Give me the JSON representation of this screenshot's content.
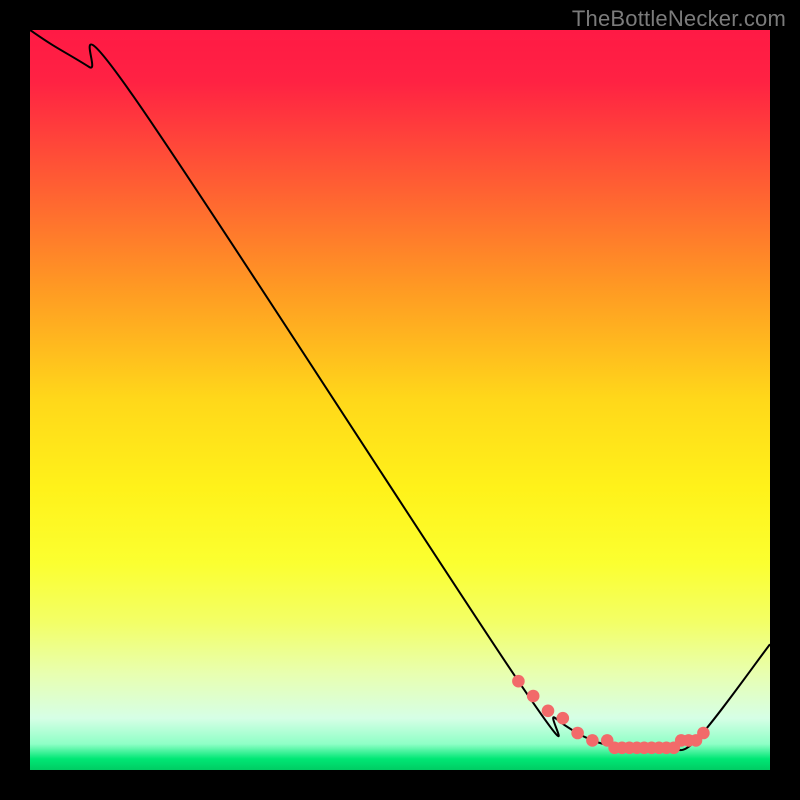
{
  "attribution": "TheBottleNecker.com",
  "chart_data": {
    "type": "line",
    "title": "",
    "xlabel": "",
    "ylabel": "",
    "xlim": [
      0,
      100
    ],
    "ylim": [
      0,
      100
    ],
    "gradient_stops": [
      {
        "offset": 0.0,
        "color": "#ff1a45"
      },
      {
        "offset": 0.07,
        "color": "#ff2243"
      },
      {
        "offset": 0.2,
        "color": "#ff5a34"
      },
      {
        "offset": 0.35,
        "color": "#ff9a23"
      },
      {
        "offset": 0.5,
        "color": "#ffd81a"
      },
      {
        "offset": 0.62,
        "color": "#fff21a"
      },
      {
        "offset": 0.72,
        "color": "#fbff30"
      },
      {
        "offset": 0.8,
        "color": "#f3ff66"
      },
      {
        "offset": 0.87,
        "color": "#e8ffb0"
      },
      {
        "offset": 0.93,
        "color": "#d6ffe6"
      },
      {
        "offset": 0.965,
        "color": "#8effc6"
      },
      {
        "offset": 0.985,
        "color": "#00e775"
      },
      {
        "offset": 1.0,
        "color": "#00cc63"
      }
    ],
    "series": [
      {
        "name": "bottleneck-curve",
        "type": "line",
        "x": [
          0,
          3,
          8,
          14,
          66,
          71,
          76,
          81,
          86,
          90,
          100
        ],
        "y": [
          100,
          98,
          95,
          91,
          12,
          7,
          4,
          3,
          3,
          4,
          17
        ]
      },
      {
        "name": "optimal-zone-markers",
        "type": "scatter",
        "x": [
          66,
          68,
          70,
          72,
          74,
          76,
          78,
          79,
          80,
          81,
          82,
          83,
          84,
          85,
          86,
          87,
          88,
          89,
          90,
          91
        ],
        "y": [
          12,
          10,
          8,
          7,
          5,
          4,
          4,
          3,
          3,
          3,
          3,
          3,
          3,
          3,
          3,
          3,
          4,
          4,
          4,
          5
        ]
      }
    ],
    "marker_color": "#f26a6a",
    "line_color": "#000000"
  }
}
